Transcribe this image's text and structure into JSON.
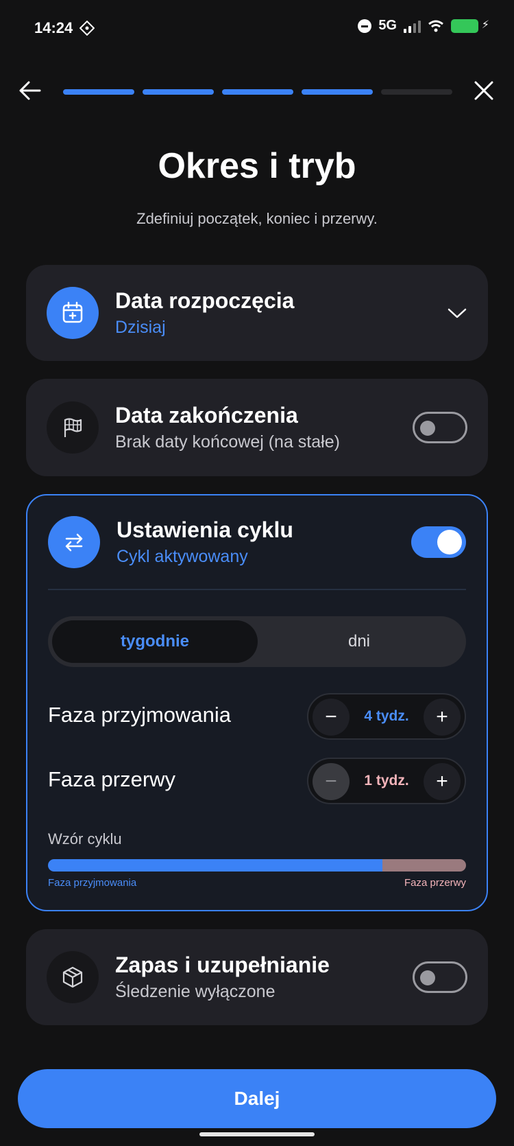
{
  "status_bar": {
    "time": "14:24",
    "network": "5G"
  },
  "progress": {
    "total_steps": 5,
    "completed_steps": 4
  },
  "header": {
    "title": "Okres i tryb",
    "subtitle": "Zdefiniuj początek, koniec i przerwy."
  },
  "start_date": {
    "title": "Data rozpoczęcia",
    "value": "Dzisiaj"
  },
  "end_date": {
    "title": "Data zakończenia",
    "value": "Brak daty końcowej (na stałe)",
    "enabled": false
  },
  "cycle": {
    "title": "Ustawienia cyklu",
    "status": "Cykl aktywowany",
    "enabled": true,
    "unit_tabs": [
      "tygodnie",
      "dni"
    ],
    "selected_unit": "tygodnie",
    "intake_label": "Faza przyjmowania",
    "intake_value": "4 tydz.",
    "break_label": "Faza przerwy",
    "break_value": "1 tydz.",
    "pattern_label": "Wzór cyklu",
    "pattern_intake_fraction": 0.8,
    "pattern_break_fraction": 0.2,
    "legend_intake": "Faza przyjmowania",
    "legend_break": "Faza przerwy"
  },
  "stock": {
    "title": "Zapas i uzupełnianie",
    "value": "Śledzenie wyłączone",
    "enabled": false
  },
  "cta": {
    "label": "Dalej"
  },
  "colors": {
    "background": "#121213",
    "card": "#212127",
    "accent_blue": "#3b82f6",
    "break_color": "#9a7a7e",
    "break_text": "#f4b4ba"
  }
}
